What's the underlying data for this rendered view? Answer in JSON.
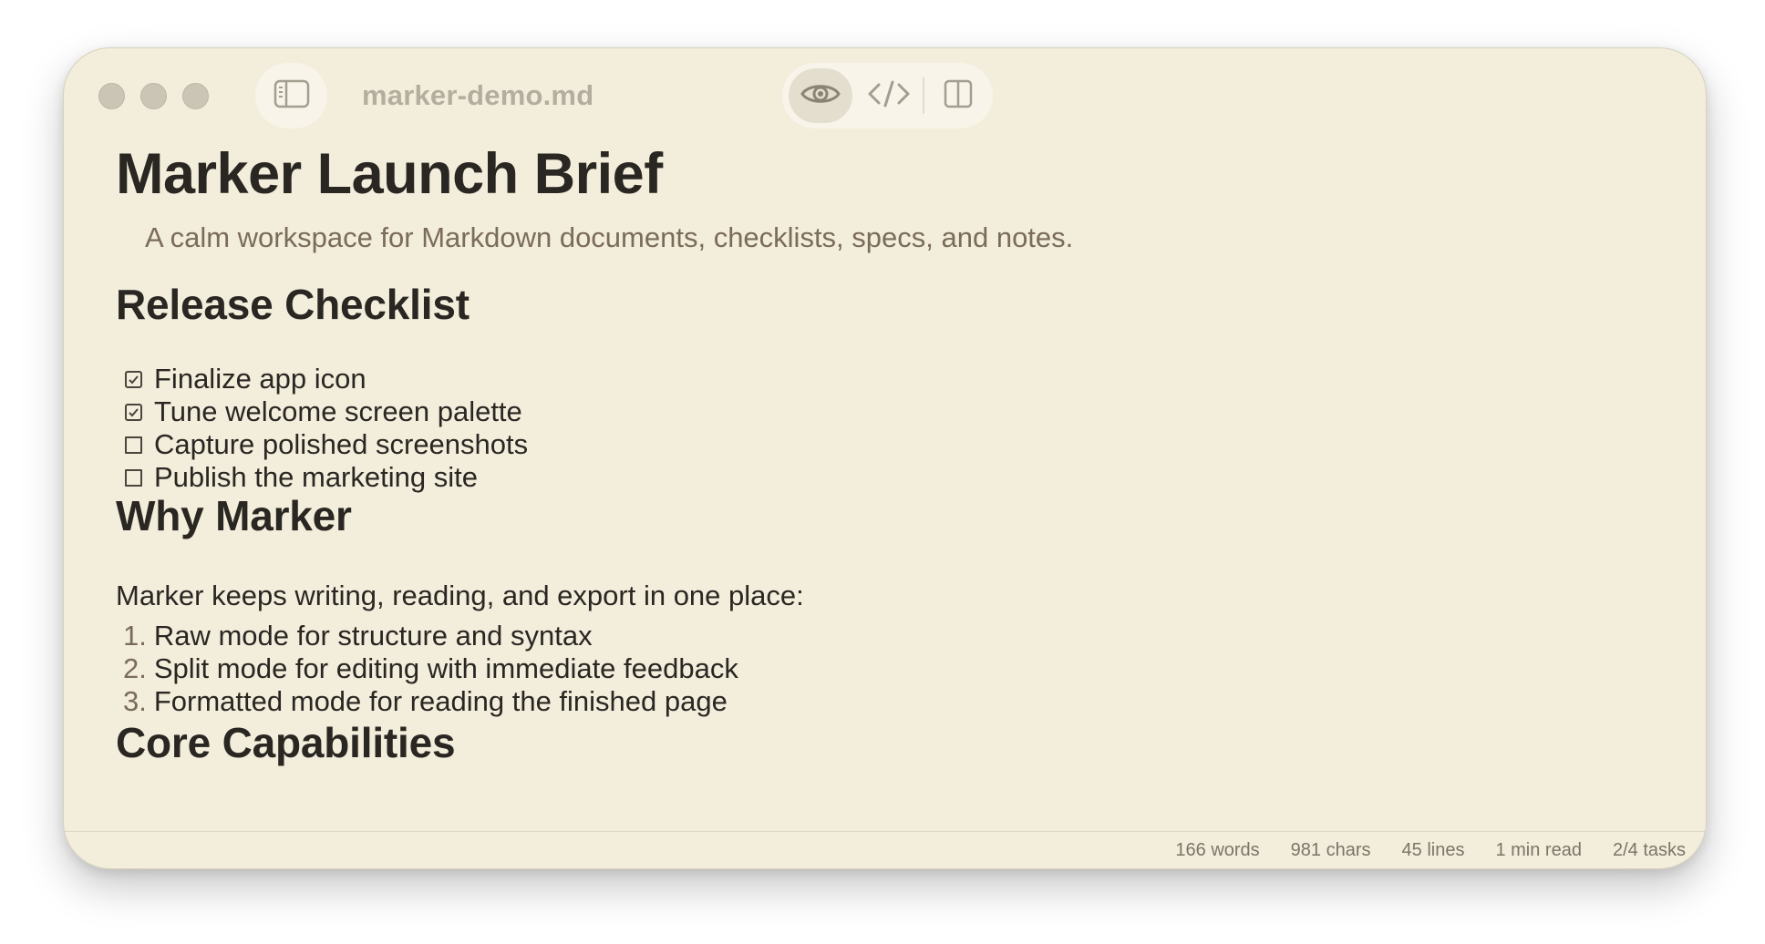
{
  "window": {
    "filename": "marker-demo.md"
  },
  "toolbar": {
    "sidebar_icon": "sidebar-icon",
    "modes": [
      {
        "name": "preview",
        "icon": "eye-icon",
        "active": true
      },
      {
        "name": "raw",
        "icon": "code-icon",
        "active": false
      },
      {
        "name": "split",
        "icon": "split-view-icon",
        "active": false
      }
    ]
  },
  "document": {
    "title": "Marker Launch Brief",
    "subtitle": "A calm workspace for Markdown documents, checklists, specs, and notes.",
    "sections": [
      {
        "heading": "Release Checklist",
        "tasks": [
          {
            "label": "Finalize app icon",
            "done": true
          },
          {
            "label": "Tune welcome screen palette",
            "done": true
          },
          {
            "label": "Capture polished screenshots",
            "done": false
          },
          {
            "label": "Publish the marketing site",
            "done": false
          }
        ]
      },
      {
        "heading": "Why Marker",
        "paragraph": "Marker keeps writing, reading, and export in one place:",
        "list": [
          {
            "num": "1.",
            "text": "Raw mode for structure and syntax"
          },
          {
            "num": "2.",
            "text": "Split mode for editing with immediate feedback"
          },
          {
            "num": "3.",
            "text": "Formatted mode for reading the finished page"
          }
        ]
      },
      {
        "heading": "Core Capabilities"
      }
    ]
  },
  "status": {
    "words": "166 words",
    "chars": "981 chars",
    "lines": "45 lines",
    "read_time": "1 min read",
    "tasks": "2/4 tasks"
  },
  "colors": {
    "window_bg": "#f3eddc",
    "text": "#2a2722",
    "muted": "#7a6c59",
    "title_muted": "#b4ae9f"
  }
}
